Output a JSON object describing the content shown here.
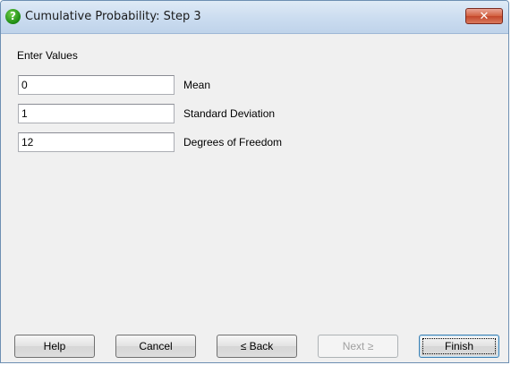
{
  "window": {
    "title": "Cumulative Probability: Step 3",
    "icon": "help-question-icon",
    "close_glyph": "✕"
  },
  "form": {
    "header": "Enter Values",
    "fields": [
      {
        "value": "0",
        "label": "Mean"
      },
      {
        "value": "1",
        "label": "Standard Deviation"
      },
      {
        "value": "12",
        "label": "Degrees of Freedom"
      }
    ]
  },
  "buttons": {
    "help": "Help",
    "cancel": "Cancel",
    "back": "≤ Back",
    "next": "Next ≥",
    "finish": "Finish"
  },
  "colors": {
    "titlebar": "#c9dbef",
    "close_button": "#c3462a",
    "icon_green": "#1c8a12",
    "client_bg": "#f0f0f0"
  }
}
